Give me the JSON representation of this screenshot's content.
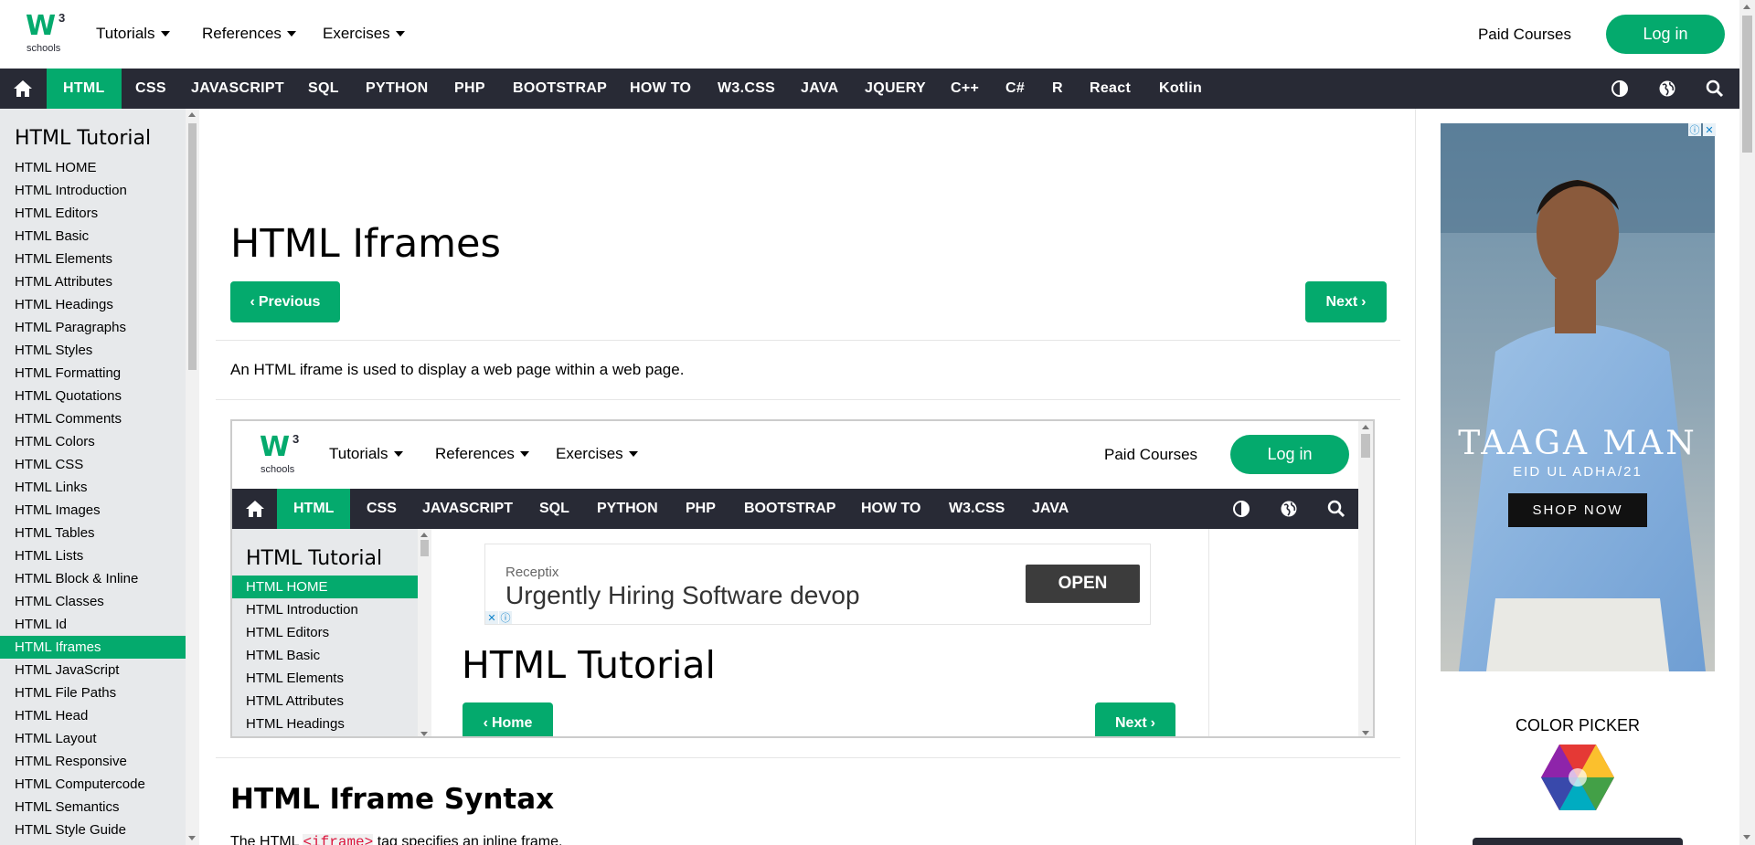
{
  "header": {
    "logo": {
      "mark": "W",
      "sup": "3",
      "text": "schools"
    },
    "nav": [
      "Tutorials",
      "References",
      "Exercises"
    ],
    "paid_courses": "Paid Courses",
    "login": "Log in"
  },
  "topnav": {
    "items": [
      "HTML",
      "CSS",
      "JAVASCRIPT",
      "SQL",
      "PYTHON",
      "PHP",
      "BOOTSTRAP",
      "HOW TO",
      "W3.CSS",
      "JAVA",
      "JQUERY",
      "C++",
      "C#",
      "R",
      "React",
      "Kotlin"
    ],
    "active": "HTML",
    "icons": [
      "home-icon",
      "contrast-icon",
      "globe-icon",
      "search-icon"
    ]
  },
  "sidebar": {
    "title": "HTML Tutorial",
    "items": [
      "HTML HOME",
      "HTML Introduction",
      "HTML Editors",
      "HTML Basic",
      "HTML Elements",
      "HTML Attributes",
      "HTML Headings",
      "HTML Paragraphs",
      "HTML Styles",
      "HTML Formatting",
      "HTML Quotations",
      "HTML Comments",
      "HTML Colors",
      "HTML CSS",
      "HTML Links",
      "HTML Images",
      "HTML Tables",
      "HTML Lists",
      "HTML Block & Inline",
      "HTML Classes",
      "HTML Id",
      "HTML Iframes",
      "HTML JavaScript",
      "HTML File Paths",
      "HTML Head",
      "HTML Layout",
      "HTML Responsive",
      "HTML Computercode",
      "HTML Semantics",
      "HTML Style Guide"
    ],
    "active": "HTML Iframes"
  },
  "main": {
    "title": "HTML Iframes",
    "prev": "Previous",
    "next": "Next",
    "intro": "An HTML iframe is used to display a web page within a web page.",
    "syntax_heading": "HTML Iframe Syntax",
    "body_prefix": "The HTML",
    "body_code": "<iframe>",
    "body_suffix": "tag specifies an inline frame."
  },
  "iframe": {
    "nav": [
      "Tutorials",
      "References",
      "Exercises"
    ],
    "paid_courses": "Paid Courses",
    "login": "Log in",
    "topnav": [
      "HTML",
      "CSS",
      "JAVASCRIPT",
      "SQL",
      "PYTHON",
      "PHP",
      "BOOTSTRAP",
      "HOW TO",
      "W3.CSS",
      "JAVA"
    ],
    "sidebar_title": "HTML Tutorial",
    "sidebar_items": [
      "HTML HOME",
      "HTML Introduction",
      "HTML Editors",
      "HTML Basic",
      "HTML Elements",
      "HTML Attributes",
      "HTML Headings"
    ],
    "sidebar_active": "HTML HOME",
    "ad": {
      "brand": "Receptix",
      "headline": "Urgently Hiring Software devop",
      "button": "OPEN"
    },
    "title": "HTML Tutorial",
    "home": "Home",
    "next": "Next"
  },
  "right": {
    "ad": {
      "brand": "TAAGA MAN",
      "sub": "EID UL ADHA/21",
      "button": "SHOP NOW"
    },
    "color_picker": "COLOR PICKER"
  },
  "colors": {
    "accent": "#04AA6D",
    "dark": "#282A35",
    "sidebar": "#E7E9EB"
  }
}
